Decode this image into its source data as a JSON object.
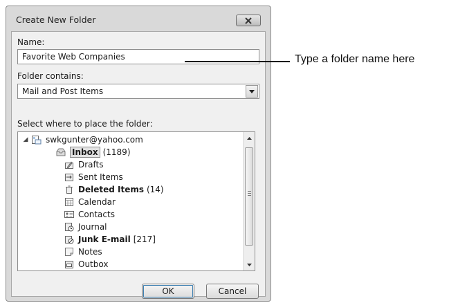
{
  "dialog": {
    "title": "Create New Folder"
  },
  "name_field": {
    "label": "Name:",
    "value": "Favorite Web Companies"
  },
  "contains_field": {
    "label": "Folder contains:",
    "value": "Mail and Post Items"
  },
  "tree": {
    "label": "Select where to place the folder:",
    "account": "swkgunter@yahoo.com",
    "items": [
      {
        "name": "Inbox",
        "count": "(1189)",
        "icon": "inbox-icon",
        "bold": true,
        "selected": true
      },
      {
        "name": "Drafts",
        "count": "",
        "icon": "drafts-icon",
        "bold": false
      },
      {
        "name": "Sent Items",
        "count": "",
        "icon": "sent-items-icon",
        "bold": false
      },
      {
        "name": "Deleted Items",
        "count": "(14)",
        "icon": "trash-icon",
        "bold": true
      },
      {
        "name": "Calendar",
        "count": "",
        "icon": "calendar-icon",
        "bold": false
      },
      {
        "name": "Contacts",
        "count": "",
        "icon": "contacts-icon",
        "bold": false
      },
      {
        "name": "Journal",
        "count": "",
        "icon": "journal-icon",
        "bold": false
      },
      {
        "name": "Junk E-mail",
        "count": "[217]",
        "icon": "junk-mail-icon",
        "bold": true
      },
      {
        "name": "Notes",
        "count": "",
        "icon": "notes-icon",
        "bold": false
      },
      {
        "name": "Outbox",
        "count": "",
        "icon": "outbox-icon",
        "bold": false
      }
    ]
  },
  "buttons": {
    "ok": "OK",
    "cancel": "Cancel"
  },
  "callout": {
    "text": "Type a folder name here"
  }
}
